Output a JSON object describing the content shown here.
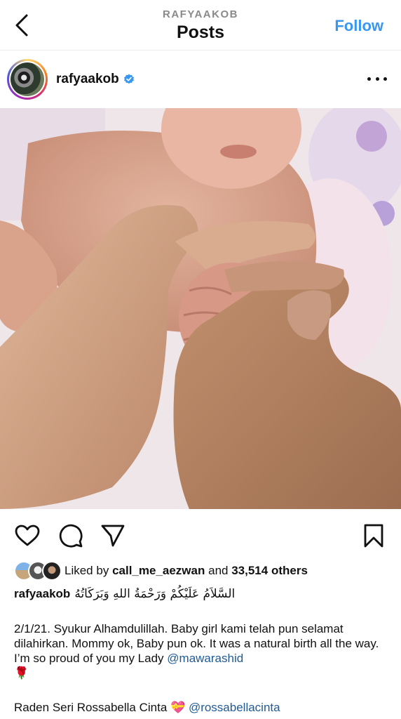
{
  "header": {
    "username": "RAFYAAKOB",
    "title": "Posts",
    "follow_label": "Follow"
  },
  "post": {
    "author": "rafyaakob",
    "verified": true,
    "icons": {
      "back": "chevron-left-icon",
      "more": "more-horizontal-icon",
      "like": "heart-icon",
      "comment": "comment-icon",
      "share": "send-icon",
      "save": "bookmark-icon"
    },
    "likes": {
      "prefix": "Liked by",
      "user": "call_me_aezwan",
      "middle": "and",
      "others": "33,514 others"
    },
    "caption": {
      "author": "rafyaakob",
      "greeting": "السَّلاَمُ عَلَيْكُمْ وَرَحْمَةُ اللهِ وَبَرَكَاتُهُ",
      "body": "2/1/21. Syukur Alhamdulillah. Baby girl kami telah pun selamat dilahirkan. Mommy ok, Baby pun ok. It was a natural birth all the way. I’m so proud of you my Lady",
      "mention1": "@mawarashid",
      "emoji1": "🌹",
      "foot_name": "Raden Seri Rossabella Cinta",
      "emoji2": "💝",
      "mention2": "@rossabellacinta"
    }
  },
  "colors": {
    "accent": "#3897f0",
    "mention": "#1f5a96",
    "muted": "#8a8a8a"
  }
}
